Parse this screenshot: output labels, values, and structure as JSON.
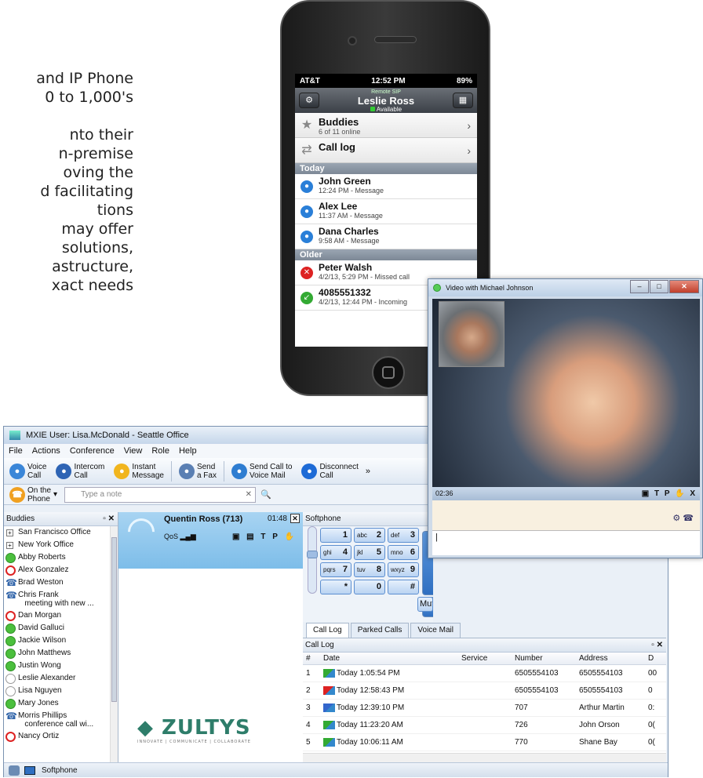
{
  "fragment": {
    "lines": [
      "and IP Phone",
      "0 to 1,000's",
      "",
      "nto their",
      "n-premise",
      "oving the",
      "d facilitating",
      "tions",
      "may offer",
      " solutions,",
      "astructure,",
      "xact needs"
    ]
  },
  "phone": {
    "status": {
      "carrier": "AT&T",
      "time": "12:52 PM",
      "battery": "89%"
    },
    "nav": {
      "sub": "Remote  SIP",
      "name": "Leslie Ross",
      "availability": "Available",
      "left_icon": "gear-icon",
      "right_icon": "keypad-icon"
    },
    "menu": [
      {
        "title": "Buddies",
        "sub": "6 of 11 online"
      },
      {
        "title": "Call log",
        "sub": ""
      }
    ],
    "sections": {
      "today": "Today",
      "older": "Older"
    },
    "today": [
      {
        "name": "John Green",
        "detail": "12:24 PM - Message"
      },
      {
        "name": "Alex Lee",
        "detail": "11:37 AM - Message"
      },
      {
        "name": "Dana Charles",
        "detail": "9:58 AM - Message"
      }
    ],
    "older": [
      {
        "name": "Peter Walsh",
        "detail": "4/2/13, 5:29 PM - Missed call"
      },
      {
        "name": "4085551332",
        "detail": "4/2/13, 12:44 PM - Incoming"
      }
    ]
  },
  "video": {
    "title": "Video with Michael Johnson",
    "elapsed": "02:36",
    "controls": "▣ T P ✋ X"
  },
  "mxie": {
    "title": "MXIE User: Lisa.McDonald - Seattle Office",
    "menu": [
      "File",
      "Actions",
      "Conference",
      "View",
      "Role",
      "Help"
    ],
    "toolbar": [
      {
        "label": "Voice\nCall",
        "icon": "phone-icon",
        "color": "#3a86d8"
      },
      {
        "label": "Intercom\nCall",
        "icon": "intercom-icon",
        "color": "#2e64b4"
      },
      {
        "label": "Instant\nMessage",
        "icon": "chat-icon",
        "color": "#f1b51e"
      },
      {
        "label": "Send\na Fax",
        "icon": "fax-icon",
        "color": "#5a7fb3"
      },
      {
        "label": "Send Call to\nVoice Mail",
        "icon": "voicemail-icon",
        "color": "#2e7dd1"
      },
      {
        "label": "Disconnect\nCall",
        "icon": "disconnect-icon",
        "color": "#1e6bd6"
      }
    ],
    "presence": "On the\nPhone",
    "note_placeholder": "Type a note",
    "buddies": {
      "header": "Buddies",
      "items": [
        {
          "name": "San Francisco Office",
          "status": "grp"
        },
        {
          "name": "New York Office",
          "status": "grp"
        },
        {
          "name": "Abby Roberts",
          "status": "g"
        },
        {
          "name": "Alex Gonzalez",
          "status": "r"
        },
        {
          "name": "Brad Weston",
          "status": "ph"
        },
        {
          "name": "Chris Frank\n   meeting with new ...",
          "status": "ph"
        },
        {
          "name": "Dan Morgan",
          "status": "r"
        },
        {
          "name": "David Galluci",
          "status": "g"
        },
        {
          "name": "Jackie Wilson",
          "status": "g"
        },
        {
          "name": "John Matthews",
          "status": "g"
        },
        {
          "name": "Justin Wong",
          "status": "g"
        },
        {
          "name": "Leslie Alexander",
          "status": "w"
        },
        {
          "name": "Lisa Nguyen",
          "status": "w"
        },
        {
          "name": "Mary Jones",
          "status": "g"
        },
        {
          "name": "Morris Phillips\n   conference call wi...",
          "status": "ph"
        },
        {
          "name": "Nancy Ortiz",
          "status": "r"
        }
      ]
    },
    "call": {
      "name": "Quentin Ross (713)",
      "time": "01:48",
      "qos": "QoS",
      "controls": "▣ ▤ T P ✋"
    },
    "brand": {
      "name": "ZULTYS",
      "tagline": "INNOVATE | COMMUNICATE | COLLABORATE"
    },
    "softphone": {
      "header": "Softphone",
      "keys": [
        {
          "l": "",
          "d": "1"
        },
        {
          "l": "abc",
          "d": "2"
        },
        {
          "l": "def",
          "d": "3"
        },
        {
          "l": "ghi",
          "d": "4"
        },
        {
          "l": "jkl",
          "d": "5"
        },
        {
          "l": "mno",
          "d": "6"
        },
        {
          "l": "pqrs",
          "d": "7"
        },
        {
          "l": "tuv",
          "d": "8"
        },
        {
          "l": "wxyz",
          "d": "9"
        },
        {
          "l": "",
          "d": "*"
        },
        {
          "l": "",
          "d": "0"
        },
        {
          "l": "",
          "d": "#"
        }
      ],
      "mute": "Mute"
    },
    "tabs": [
      "Call Log",
      "Parked Calls",
      "Voice Mail"
    ],
    "calllog": {
      "title": "Call Log",
      "columns": [
        "#",
        "Date",
        "Service",
        "Number",
        "Address",
        "D"
      ],
      "rows": [
        {
          "n": "1",
          "date": "Today 1:05:54 PM",
          "service": "",
          "number": "6505554103",
          "address": "6505554103",
          "d": "00",
          "kind": "in"
        },
        {
          "n": "2",
          "date": "Today 12:58:43 PM",
          "service": "",
          "number": "6505554103",
          "address": "6505554103",
          "d": "0",
          "kind": "miss"
        },
        {
          "n": "3",
          "date": "Today 12:39:10 PM",
          "service": "",
          "number": "707",
          "address": "Arthur Martin",
          "d": "0:",
          "kind": "out"
        },
        {
          "n": "4",
          "date": "Today 11:23:20 AM",
          "service": "",
          "number": "726",
          "address": "John Orson",
          "d": "0(",
          "kind": "in"
        },
        {
          "n": "5",
          "date": "Today 10:06:11 AM",
          "service": "",
          "number": "770",
          "address": "Shane Bay",
          "d": "0(",
          "kind": "in"
        }
      ]
    },
    "statusbar": "Softphone"
  }
}
